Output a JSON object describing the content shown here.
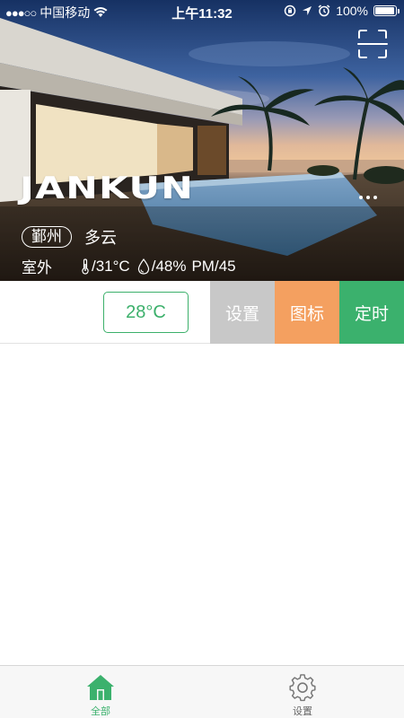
{
  "status_bar": {
    "signal_dots": "●●●○○",
    "carrier": "中国移动",
    "time": "上午11:32",
    "battery": "100%",
    "battery_level": 1.0
  },
  "hero": {
    "brand": "JANKUN",
    "city": "鄞州",
    "weather": "多云",
    "outdoor_label": "室外",
    "temperature": "/31°C",
    "humidity": "/48%",
    "pm": "PM/45"
  },
  "control": {
    "set_temperature": "28°C",
    "actions": {
      "settings": "设置",
      "icon": "图标",
      "timer": "定时"
    }
  },
  "tabbar": {
    "tabs": [
      {
        "label": "全部",
        "icon": "home-icon",
        "active": true
      },
      {
        "label": "设置",
        "icon": "gear-icon",
        "active": false
      }
    ]
  },
  "colors": {
    "accent_green": "#3bb16d",
    "action_gray": "#c8c8c8",
    "action_orange": "#f4a060"
  }
}
